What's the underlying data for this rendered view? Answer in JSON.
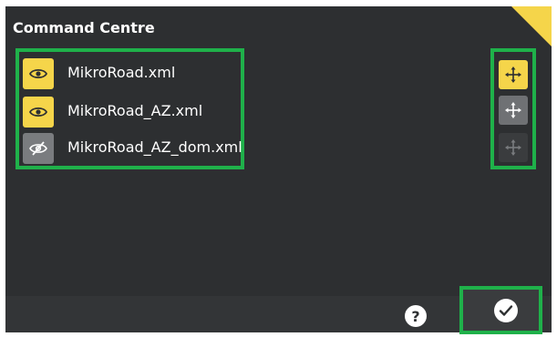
{
  "window": {
    "title": "Command Centre"
  },
  "files": [
    {
      "name": "MikroRoad.xml",
      "visible": true,
      "icon": "eye-icon"
    },
    {
      "name": "MikroRoad_AZ.xml",
      "visible": true,
      "icon": "eye-icon"
    },
    {
      "name": "MikroRoad_AZ_dom.xml",
      "visible": false,
      "icon": "eye-slash-icon"
    }
  ],
  "move_buttons": [
    {
      "icon": "move-arrows-icon",
      "state": "active"
    },
    {
      "icon": "move-arrows-icon",
      "state": "enabled"
    },
    {
      "icon": "move-arrows-icon",
      "state": "disabled"
    }
  ],
  "footer": {
    "help_label": "?",
    "confirm_icon": "checkmark-icon"
  },
  "colors": {
    "accent": "#f5d54a",
    "highlight": "#1fb14a",
    "background": "#2d2f31"
  }
}
